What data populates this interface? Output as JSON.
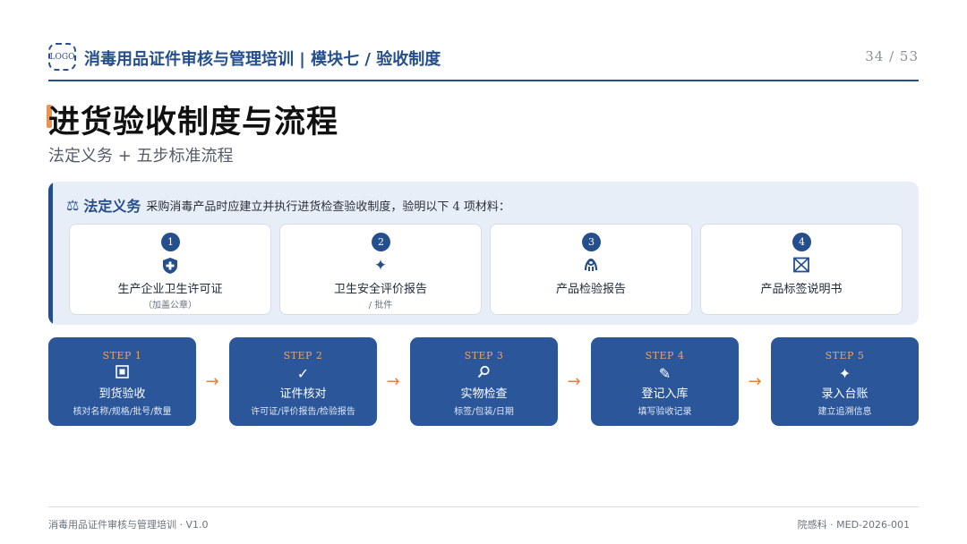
{
  "header": {
    "logo_text": "LOGO",
    "title": "消毒用品证件审核与管理培训 | 模块七 / 验收制度",
    "page_number": "34 / 53"
  },
  "title": {
    "main": "进货验收制度与流程",
    "subtitle": "法定义务 + 五步标准流程"
  },
  "legal": {
    "label": "法定义务",
    "text": "采购消毒产品时应建立并执行进货检查验收制度，验明以下 4 项材料：",
    "materials": [
      {
        "num": "1",
        "icon": "shield-plus-icon",
        "name": "生产企业卫生许可证",
        "note": "（加盖公章）"
      },
      {
        "num": "2",
        "icon": "sparkle-icon",
        "name": "卫生安全评价报告",
        "note": "/ 批件"
      },
      {
        "num": "3",
        "icon": "lab-icon",
        "name": "产品检验报告",
        "note": ""
      },
      {
        "num": "4",
        "icon": "label-box-icon",
        "name": "产品标签说明书",
        "note": ""
      }
    ]
  },
  "steps": [
    {
      "label": "STEP 1",
      "icon": "receive-icon",
      "name": "到货验收",
      "desc": "核对名称/规格/批号/数量"
    },
    {
      "label": "STEP 2",
      "icon": "check-icon",
      "name": "证件核对",
      "desc": "许可证/评价报告/检验报告"
    },
    {
      "label": "STEP 3",
      "icon": "magnifier-icon",
      "name": "实物检查",
      "desc": "标签/包装/日期"
    },
    {
      "label": "STEP 4",
      "icon": "pencil-icon",
      "name": "登记入库",
      "desc": "填写验收记录"
    },
    {
      "label": "STEP 5",
      "icon": "sparkle-icon",
      "name": "录入台账",
      "desc": "建立追溯信息"
    }
  ],
  "footer": {
    "left": "消毒用品证件审核与管理培训 · V1.0",
    "right": "院感科 · MED-2026-001"
  },
  "colors": {
    "primary": "#244e8c",
    "step_bg": "#2b579a",
    "accent": "#e2833a",
    "panel_bg": "#e8eef7"
  }
}
